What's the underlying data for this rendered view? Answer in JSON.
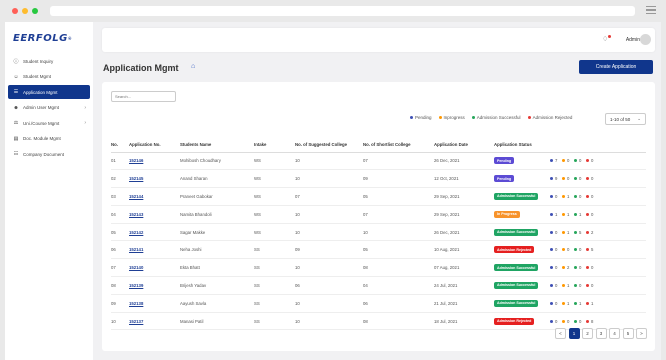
{
  "brand": {
    "logo_text": "EERFOLG",
    "logo_mark": "®"
  },
  "sidebar": {
    "items": [
      {
        "label": "Student Inquiry",
        "icon": "inquiry-icon",
        "active": false,
        "chevron": false
      },
      {
        "label": "Student Mgmt",
        "icon": "student-icon",
        "active": false,
        "chevron": false
      },
      {
        "label": "Application Mgmt",
        "icon": "application-icon",
        "active": true,
        "chevron": false
      },
      {
        "label": "Admin User Mgmt",
        "icon": "admin-user-icon",
        "active": false,
        "chevron": true
      },
      {
        "label": "Uni./Course Mgmt",
        "icon": "university-icon",
        "active": false,
        "chevron": true
      },
      {
        "label": "Doc. Module Mgmt",
        "icon": "document-module-icon",
        "active": false,
        "chevron": false
      },
      {
        "label": "Company Document",
        "icon": "company-document-icon",
        "active": false,
        "chevron": false
      }
    ]
  },
  "header": {
    "user_name": "Admin"
  },
  "page": {
    "title": "Application Mgmt",
    "create_button": "Create Application"
  },
  "filters": {
    "search_placeholder": "Search...",
    "per_page": "1-10 of 50",
    "legend": [
      {
        "label": "Pending",
        "color": "#3f51b5"
      },
      {
        "label": "Inprogress",
        "color": "#ff9800"
      },
      {
        "label": "Admission Successful",
        "color": "#26a65b"
      },
      {
        "label": "Admission Rejected",
        "color": "#e53935"
      }
    ]
  },
  "table": {
    "headers": [
      "No.",
      "Application No.",
      "Students Name",
      "Intake",
      "No. of Suggested College",
      "No. of Shortlist College",
      "Application Date",
      "Application Status"
    ],
    "rows": [
      {
        "no": "01",
        "app": "152146",
        "name": "Mohibosh Choudhary",
        "intake": "WS",
        "suggested": "10",
        "shortlist": "07",
        "date": "26 Dec, 2021",
        "status": "Pending",
        "status_color": "#5c4bd4",
        "counts": [
          "7",
          "0",
          "0",
          "0"
        ]
      },
      {
        "no": "02",
        "app": "152145",
        "name": "Anand Sharan",
        "intake": "WS",
        "suggested": "10",
        "shortlist": "09",
        "date": "12 Oct, 2021",
        "status": "Pending",
        "status_color": "#5c4bd4",
        "counts": [
          "9",
          "0",
          "0",
          "0"
        ]
      },
      {
        "no": "03",
        "app": "152144",
        "name": "Praneet Gabokar",
        "intake": "WS",
        "suggested": "07",
        "shortlist": "05",
        "date": "29 Sep, 2021",
        "status": "Admission Successful",
        "status_color": "#1fa463",
        "counts": [
          "0",
          "1",
          "0",
          "0"
        ]
      },
      {
        "no": "04",
        "app": "152143",
        "name": "Namita Bhandoli",
        "intake": "WS",
        "suggested": "10",
        "shortlist": "07",
        "date": "29 Sep, 2021",
        "status": "In Progress",
        "status_color": "#f7932b",
        "counts": [
          "1",
          "1",
          "1",
          "0"
        ]
      },
      {
        "no": "05",
        "app": "152142",
        "name": "Sagar Makke",
        "intake": "WS",
        "suggested": "10",
        "shortlist": "10",
        "date": "26 Dec, 2021",
        "status": "Admission Successful",
        "status_color": "#1fa463",
        "counts": [
          "0",
          "1",
          "5",
          "2"
        ]
      },
      {
        "no": "06",
        "app": "152141",
        "name": "Neha Joshi",
        "intake": "SS",
        "suggested": "09",
        "shortlist": "05",
        "date": "10 Aug, 2021",
        "status": "Admission Rejected",
        "status_color": "#e52020",
        "counts": [
          "0",
          "0",
          "0",
          "5"
        ]
      },
      {
        "no": "07",
        "app": "152140",
        "name": "Ekta Bhatt",
        "intake": "SS",
        "suggested": "10",
        "shortlist": "08",
        "date": "07 Aug, 2021",
        "status": "Admission Successful",
        "status_color": "#1fa463",
        "counts": [
          "0",
          "2",
          "0",
          "0"
        ]
      },
      {
        "no": "08",
        "app": "152139",
        "name": "Brijesh Yadav",
        "intake": "SS",
        "suggested": "06",
        "shortlist": "04",
        "date": "24 Jul, 2021",
        "status": "Admission Successful",
        "status_color": "#1fa463",
        "counts": [
          "0",
          "1",
          "0",
          "0"
        ]
      },
      {
        "no": "09",
        "app": "152138",
        "name": "Aayush Savla",
        "intake": "SS",
        "suggested": "10",
        "shortlist": "06",
        "date": "21 Jul, 2021",
        "status": "Admission Successful",
        "status_color": "#1fa463",
        "counts": [
          "0",
          "1",
          "1",
          "1"
        ]
      },
      {
        "no": "10",
        "app": "152137",
        "name": "Manasi Patil",
        "intake": "SS",
        "suggested": "10",
        "shortlist": "08",
        "date": "18 Jul, 2021",
        "status": "Admission Rejected",
        "status_color": "#e52020",
        "counts": [
          "0",
          "0",
          "0",
          "8"
        ]
      }
    ],
    "count_colors": [
      "#3f51b5",
      "#ff9800",
      "#26a65b",
      "#e53935"
    ]
  },
  "pagination": {
    "prev": "<",
    "pages": [
      "1",
      "2",
      "3",
      "4",
      "5"
    ],
    "active_page": "1",
    "next": ">"
  }
}
